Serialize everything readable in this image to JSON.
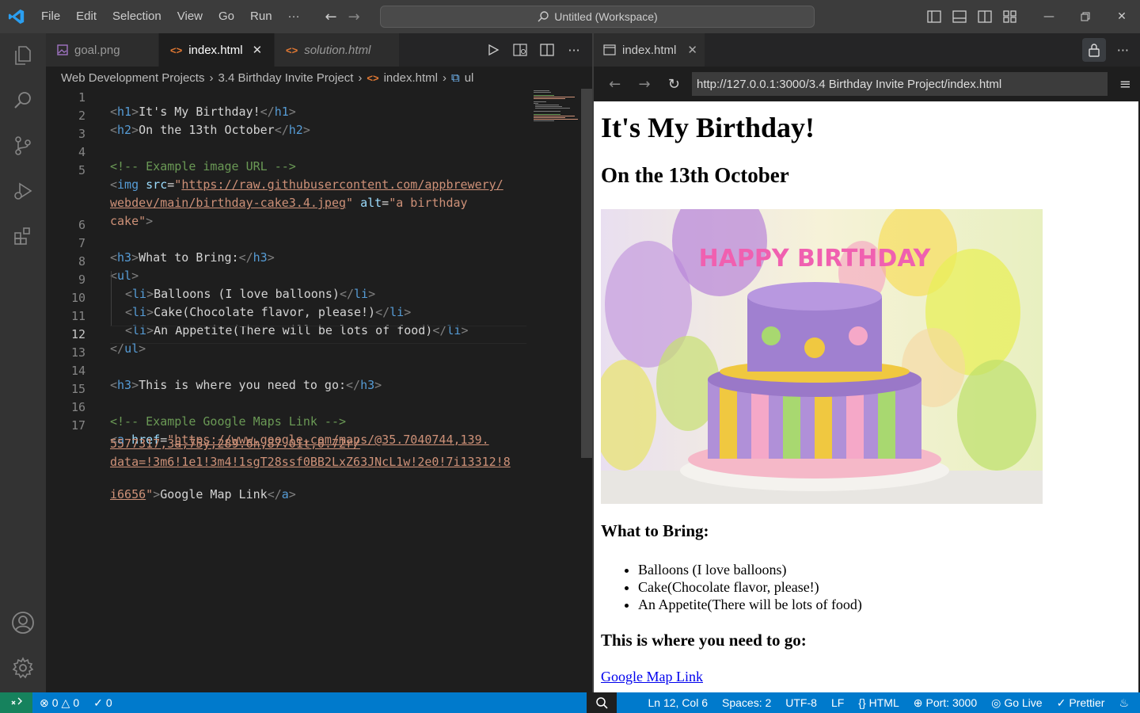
{
  "titlebar": {
    "menu": [
      "File",
      "Edit",
      "Selection",
      "View",
      "Go",
      "Run"
    ],
    "more": "···",
    "search": "Untitled (Workspace)"
  },
  "editor": {
    "tabs": [
      {
        "label": "goal.png",
        "italic": false
      },
      {
        "label": "index.html",
        "italic": false,
        "active": true,
        "close": "✕"
      },
      {
        "label": "solution.html",
        "italic": true
      }
    ],
    "breadcrumb": [
      "Web Development Projects",
      "3.4 Birthday Invite Project",
      "index.html",
      "ul"
    ],
    "line_numbers": [
      "1",
      "2",
      "3",
      "4",
      "5",
      "",
      "",
      "6",
      "7",
      "8",
      "9",
      "10",
      "11",
      "12",
      "13",
      "14",
      "15",
      "16",
      "17",
      "",
      "",
      ""
    ],
    "lines": {
      "l1": {
        "a": "<",
        "b": "h1",
        "c": ">",
        "d": "It's My Birthday!",
        "e": "</",
        "f": "h1",
        "g": ">"
      },
      "l2": {
        "a": "<",
        "b": "h2",
        "c": ">",
        "d": "On the 13th October",
        "e": "</",
        "f": "h2",
        "g": ">"
      },
      "l4": "<!-- Example image URL -->",
      "l5a": {
        "a": "<",
        "b": "img",
        "sp": " ",
        "at1": "src",
        "eq": "=",
        "q": "\"",
        "url1": "https://raw.githubusercontent.com/appbrewery/"
      },
      "l5b": {
        "url2": "webdev/main/birthday-cake3.4.jpeg",
        "q": "\"",
        "sp": " ",
        "at2": "alt",
        "eq": "=",
        "val": "\"a birthday"
      },
      "l5c": {
        "val": "cake\"",
        "c": ">"
      },
      "l7": {
        "a": "<",
        "b": "h3",
        "c": ">",
        "d": "What to Bring:",
        "e": "</",
        "f": "h3",
        "g": ">"
      },
      "l8": {
        "a": "<",
        "b": "ul",
        "c": ">"
      },
      "l9": {
        "a": "<",
        "b": "li",
        "c": ">",
        "d": "Balloons (I love balloons)",
        "e": "</",
        "f": "li",
        "g": ">"
      },
      "l10": {
        "a": "<",
        "b": "li",
        "c": ">",
        "d": "Cake(Chocolate flavor, please!)",
        "e": "</",
        "f": "li",
        "g": ">"
      },
      "l11": {
        "a": "<",
        "b": "li",
        "c": ">",
        "d": "An Appetite(There will be lots of food)",
        "e": "</",
        "f": "li",
        "g": ">"
      },
      "l12": {
        "a": "</",
        "b": "ul",
        "c": ">"
      },
      "l14": {
        "a": "<",
        "b": "h3",
        "c": ">",
        "d": "This is where you need to go:",
        "e": "</",
        "f": "h3",
        "g": ">"
      },
      "l16": "<!-- Example Google Maps Link -->",
      "l17a": {
        "a": "<",
        "b": "a",
        "sp": " ",
        "at": "href",
        "eq": "=",
        "q": "\"",
        "url": "https://www.google.com/maps/@35.7040744,139."
      },
      "l17b": "5577317,3a,75y,289.6h,87.01t,0.72r/",
      "l17c": "data=!3m6!1e1!3m4!1sgT28ssf0BB2LxZ63JNcL1w!2e0!7i13312!8",
      "l17d": {
        "url": "i6656",
        "q": "\"",
        "c": ">",
        "d": "Google Map Link",
        "e": "</",
        "f": "a",
        "g": ">"
      }
    }
  },
  "browser": {
    "tab": "index.html",
    "close": "✕",
    "url": "http://127.0.0.1:3000/3.4 Birthday Invite Project/index.html",
    "page": {
      "h1": "It's My Birthday!",
      "h2": "On the 13th October",
      "image_alt": "a birthday cake",
      "cake_text": "HAPPY BIRTHDAY",
      "h3_bring": "What to Bring:",
      "items": [
        "Balloons (I love balloons)",
        "Cake(Chocolate flavor, please!)",
        "An Appetite(There will be lots of food)"
      ],
      "h3_go": "This is where you need to go:",
      "link": "Google Map Link"
    }
  },
  "status": {
    "errors": "0",
    "warnings": "0",
    "ports": "0",
    "position": "Ln 12, Col 6",
    "spaces": "Spaces: 2",
    "encoding": "UTF-8",
    "eol": "LF",
    "language": "HTML",
    "port": "Port: 3000",
    "golive": "Go Live",
    "prettier": "Prettier"
  },
  "colors": {
    "accent": "#007acc",
    "remote": "#16825d",
    "tag": "#569cd6",
    "attr": "#9cdcfe",
    "string": "#ce9178",
    "comment": "#6a9955"
  },
  "icons": [
    "vscode-logo-icon",
    "explorer-icon",
    "search-icon",
    "source-control-icon",
    "run-debug-icon",
    "extensions-icon",
    "account-icon",
    "settings-gear-icon",
    "html-file-icon",
    "image-file-icon",
    "run-icon",
    "open-preview-icon",
    "split-editor-icon",
    "more-icon",
    "lock-icon",
    "menu-icon",
    "back-icon",
    "forward-icon",
    "reload-icon",
    "remote-icon",
    "error-icon",
    "warning-icon",
    "broadcast-icon",
    "zoom-icon",
    "bell-icon"
  ]
}
